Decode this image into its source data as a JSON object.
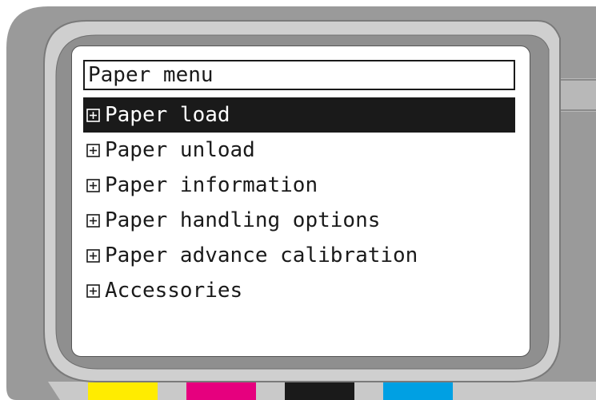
{
  "screen": {
    "title": "Paper menu",
    "selected_index": 0,
    "items": [
      {
        "label": "Paper load",
        "icon": "expand-plus-icon"
      },
      {
        "label": "Paper unload",
        "icon": "expand-plus-icon"
      },
      {
        "label": "Paper information",
        "icon": "expand-plus-icon"
      },
      {
        "label": "Paper handling options",
        "icon": "expand-plus-icon"
      },
      {
        "label": "Paper advance calibration",
        "icon": "expand-plus-icon"
      },
      {
        "label": "Accessories",
        "icon": "expand-plus-icon"
      }
    ]
  },
  "ink_colors": {
    "yellow": "#ffec00",
    "magenta": "#e6007e",
    "black": "#1a1a1a",
    "cyan": "#00a0e3"
  }
}
